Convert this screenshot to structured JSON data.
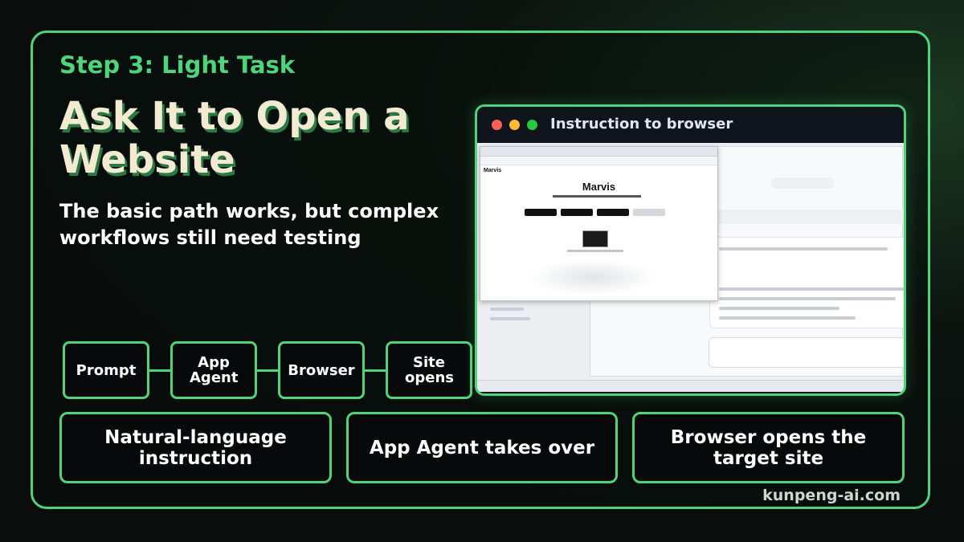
{
  "step_label": "Step 3: Light Task",
  "title": "Ask It to Open a Website",
  "subtitle": "The basic path works, but complex workflows still need testing",
  "flow": [
    {
      "label": "Prompt"
    },
    {
      "label": "App Agent"
    },
    {
      "label": "Browser"
    },
    {
      "label": "Site opens"
    }
  ],
  "details": [
    {
      "label": "Natural-language instruction"
    },
    {
      "label": "App Agent takes over"
    },
    {
      "label": "Browser opens the target site"
    }
  ],
  "window": {
    "title": "Instruction to browser",
    "browser_brand_small": "Marvis",
    "browser_brand_big": "Marvis"
  },
  "footer": "kunpeng-ai.com",
  "colors": {
    "accent": "#4fd37b",
    "title_cream": "#f3ead2",
    "dot_red": "#ff5f57",
    "dot_yellow": "#febc2e",
    "dot_green": "#28c840"
  }
}
